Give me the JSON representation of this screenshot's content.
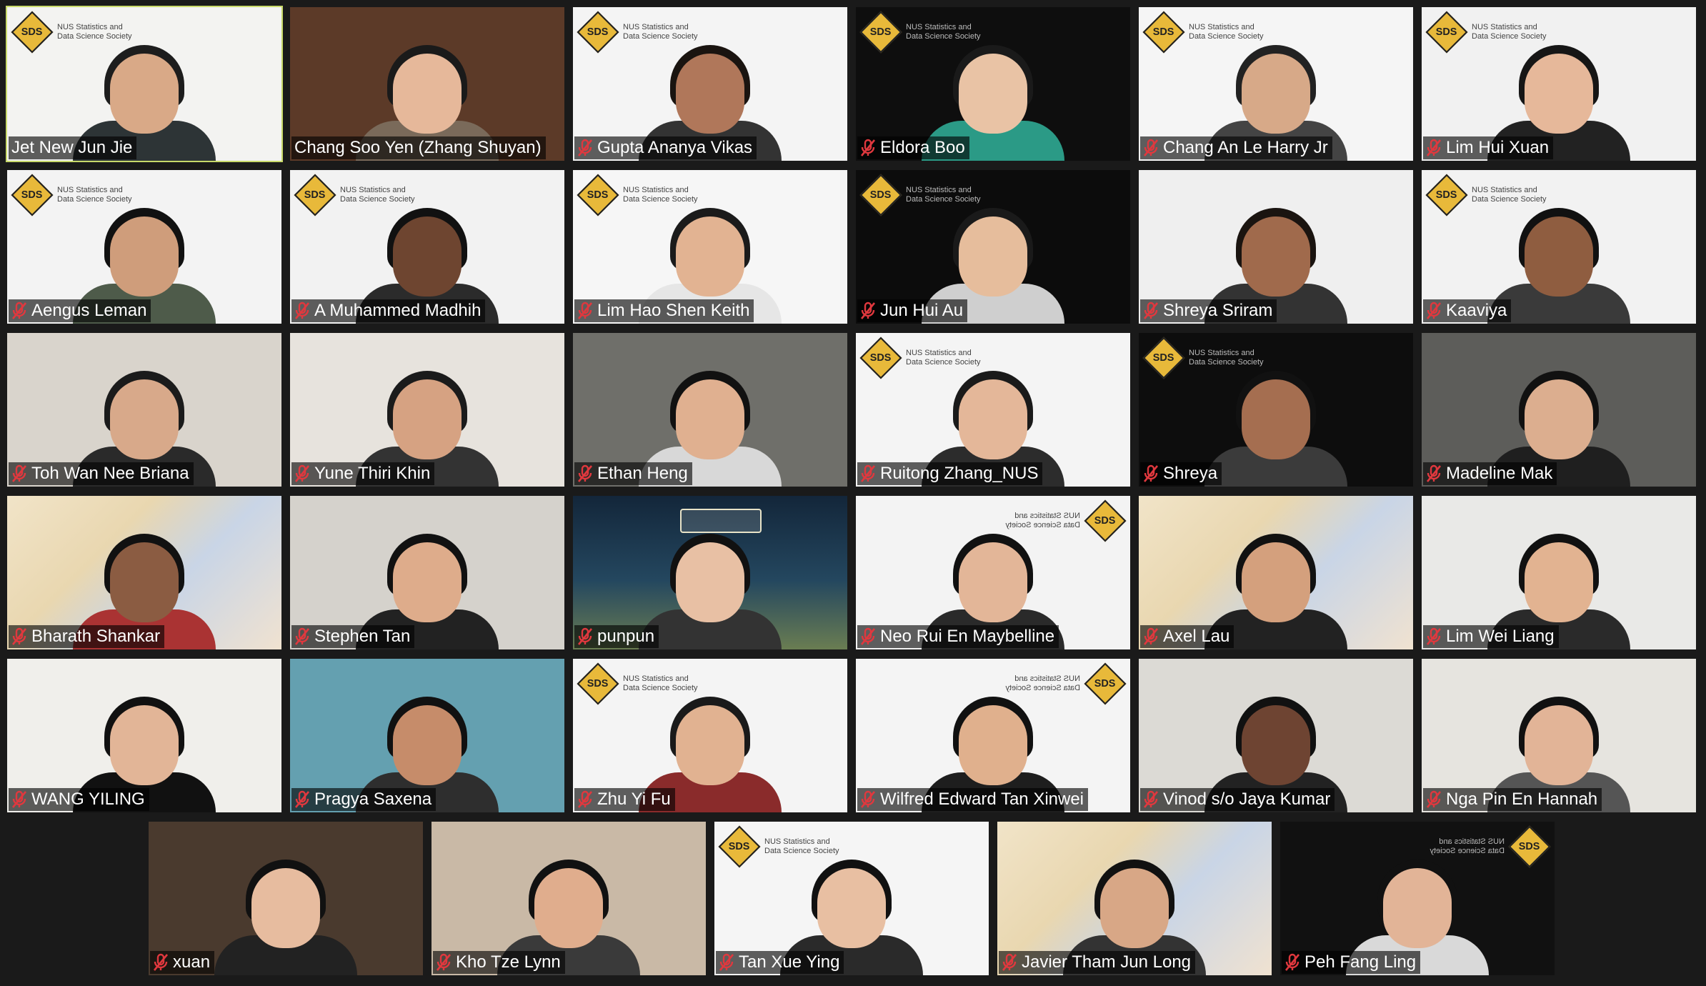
{
  "meeting": {
    "logo_text": "NUS Statistics and Data Science Society",
    "participants": [
      {
        "name": "Jet New Jun Jie",
        "muted": false,
        "active": true,
        "bg": "#f3f3f1",
        "logo": true,
        "skin": "#d9a987",
        "hair": "#1d1d1d",
        "shirt": "#2d3436"
      },
      {
        "name": "Chang Soo Yen (Zhang Shuyan)",
        "muted": false,
        "bg": "#5c3a28",
        "skin": "#e6b89a",
        "hair": "#1a1a1a",
        "shirt": "#7a6a5a"
      },
      {
        "name": "Gupta Ananya Vikas",
        "muted": true,
        "bg": "#f4f4f4",
        "logo": true,
        "skin": "#b0775a",
        "hair": "#1a1410",
        "shirt": "#333"
      },
      {
        "name": "Eldora Boo",
        "muted": true,
        "bg": "#0e0e0e",
        "logo": true,
        "dark": true,
        "skin": "#e9c3a5",
        "hair": "#1a1a1a",
        "shirt": "#2b9a86"
      },
      {
        "name": "Chang An Le Harry Jr",
        "muted": true,
        "bg": "#f5f5f5",
        "logo": true,
        "skin": "#d7a988",
        "hair": "#222",
        "shirt": "#444"
      },
      {
        "name": "Lim Hui Xuan",
        "muted": true,
        "bg": "#f1f1f1",
        "logo": true,
        "skin": "#e6b89a",
        "hair": "#161616",
        "shirt": "#222"
      },
      {
        "name": "Aengus Leman",
        "muted": true,
        "bg": "#f3f3f3",
        "logo": true,
        "skin": "#cf9d7b",
        "hair": "#111",
        "shirt": "#4e5b4a"
      },
      {
        "name": "A Muhammed Madhih",
        "muted": true,
        "bg": "#f2f2f2",
        "logo": true,
        "skin": "#6e4530",
        "hair": "#111",
        "shirt": "#2b2b2b"
      },
      {
        "name": "Lim Hao Shen Keith",
        "muted": true,
        "bg": "#f6f6f6",
        "logo": true,
        "skin": "#e2b392",
        "hair": "#1b1b1b",
        "shirt": "#e6e6e6"
      },
      {
        "name": "Jun Hui Au",
        "muted": true,
        "bg": "#0c0c0c",
        "logo": true,
        "dark": true,
        "skin": "#e6bd9c",
        "hair": "#1a1a1a",
        "shirt": "#cfcfcf"
      },
      {
        "name": "Shreya Sriram",
        "muted": true,
        "bg": "#efefef",
        "skin": "#a06a4c",
        "hair": "#1a1410",
        "shirt": "#333"
      },
      {
        "name": "Kaaviya",
        "muted": true,
        "bg": "#f2f2f2",
        "logo": true,
        "skin": "#8f5d40",
        "hair": "#111",
        "shirt": "#3a3a3a"
      },
      {
        "name": "Toh Wan Nee Briana",
        "muted": true,
        "bg": "#d9d4cc",
        "skin": "#d8a98a",
        "hair": "#1b1b1b",
        "shirt": "#2a2a2a"
      },
      {
        "name": "Yune Thiri Khin",
        "muted": true,
        "bg": "#e7e3dd",
        "skin": "#d6a282",
        "hair": "#1b1b1b",
        "shirt": "#333"
      },
      {
        "name": "Ethan Heng",
        "muted": true,
        "bg": "#6f6f6a",
        "skin": "#e0b090",
        "hair": "#111",
        "shirt": "#d8d8d8"
      },
      {
        "name": "Ruitong Zhang_NUS",
        "muted": true,
        "bg": "#f4f4f4",
        "logo": true,
        "skin": "#e4b799",
        "hair": "#1a1a1a",
        "shirt": "#2c2c2c"
      },
      {
        "name": "Shreya",
        "muted": true,
        "bg": "#0d0d0d",
        "logo": true,
        "dark": true,
        "skin": "#a56e50",
        "hair": "#111",
        "shirt": "#3b3b3b"
      },
      {
        "name": "Madeline Mak",
        "muted": true,
        "bg": "#5d5d5a",
        "skin": "#dcae8f",
        "hair": "#111",
        "shirt": "#1f1f1f"
      },
      {
        "name": "Bharath Shankar",
        "muted": true,
        "bg": "#e8e0d2",
        "anime": true,
        "skin": "#8b5c42",
        "hair": "#111",
        "shirt": "#a33"
      },
      {
        "name": "Stephen Tan",
        "muted": true,
        "bg": "#d5d2cc",
        "skin": "#deac8b",
        "hair": "#111",
        "shirt": "#222"
      },
      {
        "name": "punpun",
        "muted": true,
        "bg": "#1e3b52",
        "coffee": true,
        "skin": "#e8c0a4",
        "hair": "#111",
        "shirt": "#333"
      },
      {
        "name": "Neo Rui En Maybelline",
        "muted": true,
        "bg": "#f3f3f3",
        "logo": true,
        "mirror": true,
        "skin": "#e3b698",
        "hair": "#111",
        "shirt": "#2a2a2a"
      },
      {
        "name": "Axel Lau",
        "muted": true,
        "bg": "#e8e0d2",
        "anime": true,
        "skin": "#d4a07d",
        "hair": "#111",
        "shirt": "#222"
      },
      {
        "name": "Lim Wei Liang",
        "muted": true,
        "bg": "#e9e9e7",
        "skin": "#e2b391",
        "hair": "#111",
        "shirt": "#2a2a2a"
      },
      {
        "name": "WANG YILING",
        "muted": true,
        "bg": "#f0efeb",
        "skin": "#e2b597",
        "hair": "#111",
        "shirt": "#111"
      },
      {
        "name": "Pragya Saxena",
        "muted": true,
        "bg": "#64a0b0",
        "skin": "#c68c6a",
        "hair": "#111",
        "shirt": "#2e2e2e"
      },
      {
        "name": "Zhu Yi Fu",
        "muted": true,
        "bg": "#f4f4f4",
        "logo": true,
        "skin": "#e1b291",
        "hair": "#1a1a1a",
        "shirt": "#8a2b2b"
      },
      {
        "name": "Wilfred Edward Tan Xinwei",
        "muted": true,
        "bg": "#f4f4f4",
        "logo": true,
        "mirror": true,
        "skin": "#e0b08d",
        "hair": "#111",
        "shirt": "#1e1e1e"
      },
      {
        "name": "Vinod s/o Jaya Kumar",
        "muted": true,
        "bg": "#dcdad5",
        "skin": "#6e4432",
        "hair": "#111",
        "shirt": "#222"
      },
      {
        "name": "Nga Pin En Hannah",
        "muted": true,
        "bg": "#e6e4df",
        "skin": "#e2b497",
        "hair": "#111",
        "shirt": "#555"
      },
      {
        "name": "xuan",
        "muted": true,
        "bg": "#4a3a2e",
        "skin": "#e7bc9f",
        "hair": "#111",
        "shirt": "#222"
      },
      {
        "name": "Kho Tze Lynn",
        "muted": true,
        "bg": "#c9b9a6",
        "skin": "#e0ad8d",
        "hair": "#111",
        "shirt": "#3a3a3a"
      },
      {
        "name": "Tan Xue Ying",
        "muted": true,
        "bg": "#f5f5f5",
        "logo": true,
        "skin": "#e8bfa2",
        "hair": "#111",
        "shirt": "#2a2a2a"
      },
      {
        "name": "Javier Tham Jun Long",
        "muted": true,
        "bg": "#e8e0d2",
        "anime": true,
        "skin": "#d8a786",
        "hair": "#111",
        "shirt": "#333"
      },
      {
        "name": "Peh Fang Ling",
        "muted": true,
        "bg": "#111111",
        "logo": true,
        "mirror": true,
        "dark": true,
        "skin": "#e2b497",
        "hair": "#111",
        "shirt": "#d9d9d9"
      }
    ]
  }
}
